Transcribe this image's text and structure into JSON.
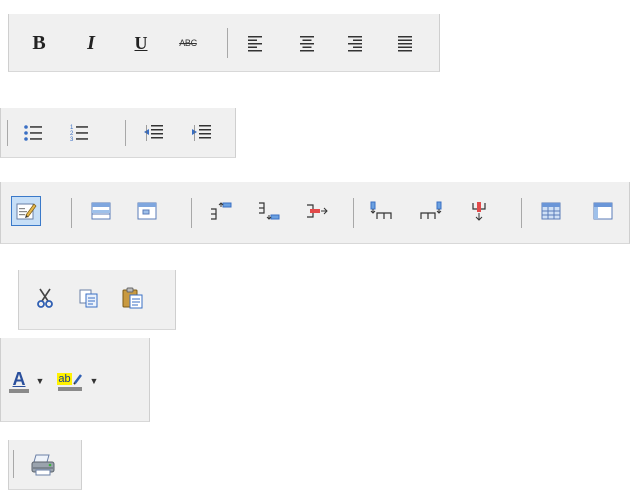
{
  "format_toolbar": {
    "bold_label": "B",
    "italic_label": "I",
    "underline_label": "U",
    "strike_label": "ABC"
  },
  "colors": {
    "toolbar_bg": "#f0f0f0",
    "active_bg": "#c7dff7",
    "active_border": "#3a79c9",
    "icon_blue": "#3a6fc4",
    "highlight_yellow": "#fff200"
  },
  "font_color_toolbar": {
    "font_color_label": "A",
    "highlight_label": "ab"
  }
}
